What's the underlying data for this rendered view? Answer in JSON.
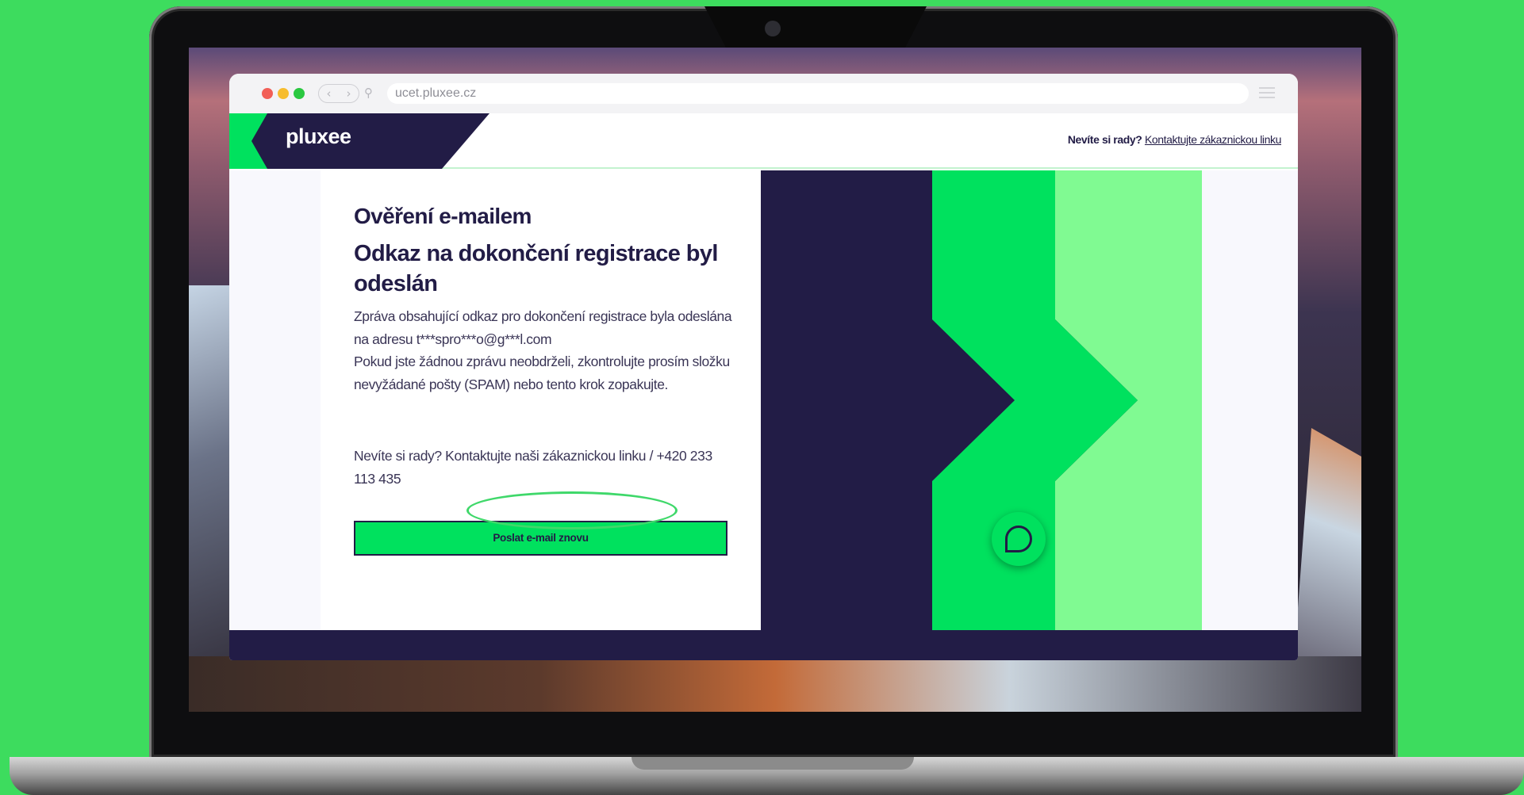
{
  "browser": {
    "url": "ucet.pluxee.cz"
  },
  "header": {
    "logo_text": "pluxee",
    "help_question": "Nevíte si rady?",
    "help_link": "Kontaktujte zákaznickou linku"
  },
  "main": {
    "title": "Ověření e-mailem",
    "subtitle": "Odkaz na dokončení registrace byl odeslán",
    "message_line1": "Zpráva obsahující odkaz pro dokončení registrace byla odeslána na adresu t***spro***o@g***l.com",
    "message_line2": "Pokud jste žádnou zprávu neobdrželi, zkontrolujte prosím složku nevyžádané pošty (SPAM) nebo tento krok zopakujte.",
    "contact_text": "Nevíte si rady? Kontaktujte naši zákaznickou linku / +420 233 113 435",
    "resend_button": "Poslat e-mail znovu"
  },
  "colors": {
    "page_background": "#3ddc5e",
    "brand_dark": "#221c46",
    "brand_green": "#00e15e",
    "brand_light_green": "#80fa92"
  },
  "icons": {
    "chat": "chat-bubble-icon"
  }
}
